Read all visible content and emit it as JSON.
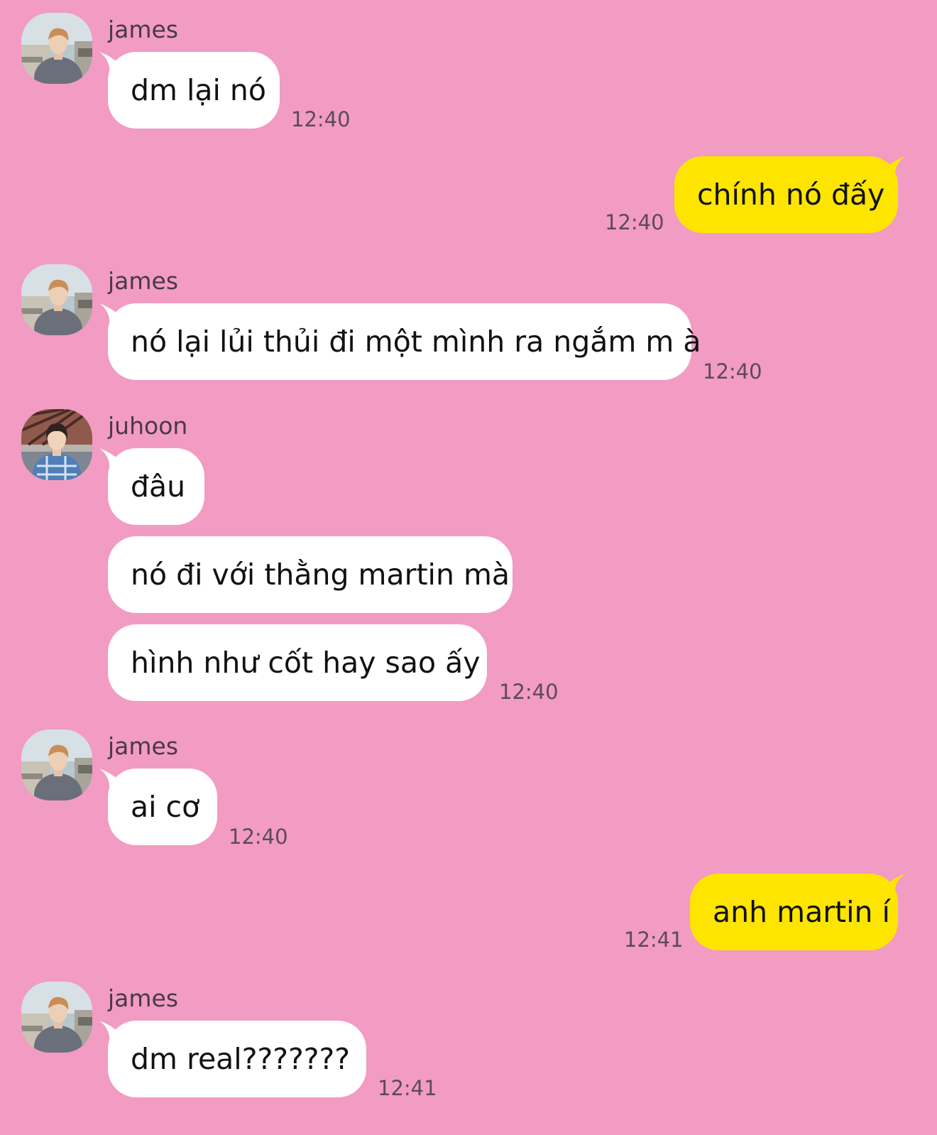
{
  "colors": {
    "background": "#f29bc3",
    "incoming_bubble": "#ffffff",
    "outgoing_bubble": "#fee500"
  },
  "messages": [
    {
      "sender": "james",
      "text": "dm lại nó",
      "time": "12:40"
    },
    {
      "sender": "me",
      "text": "chính nó đấy",
      "time": "12:40"
    },
    {
      "sender": "james",
      "text": "nó lại lủi thủi đi một mình ra ngắm m à",
      "time": "12:40"
    },
    {
      "sender": "juhoon",
      "texts": [
        "đâu",
        "nó đi với thằng martin mà",
        "hình như cốt hay sao ấy"
      ],
      "time": "12:40"
    },
    {
      "sender": "james",
      "text": "ai cơ",
      "time": "12:40"
    },
    {
      "sender": "me",
      "text": "anh martin í",
      "time": "12:41"
    },
    {
      "sender": "james",
      "text": "dm real???????",
      "time": "12:41"
    }
  ]
}
